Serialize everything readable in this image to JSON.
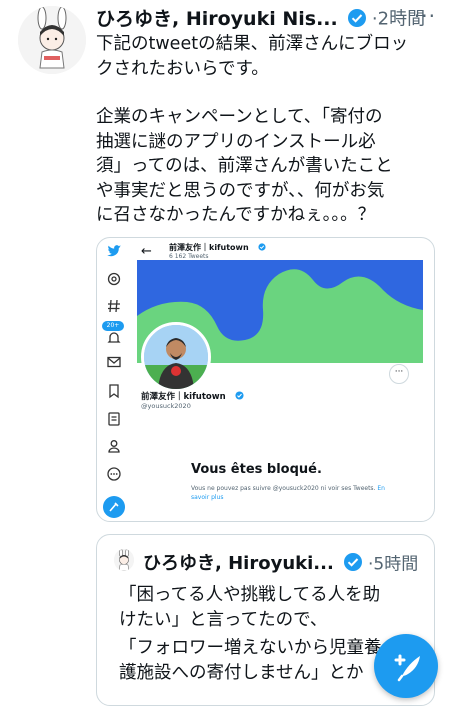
{
  "tweet": {
    "author_name": "ひろゆき, Hiroyuki Nis...",
    "time": "·2時間",
    "more_label": "···",
    "paragraph1": "下記のtweetの結果、前澤さんにブロッ\nクされたおいらです。",
    "paragraph2": "企業のキャンペーンとして、「寄付の\n抽選に謎のアプリのインストール必\n須」ってのは、前澤さんが書いたこと\nや事実だと思うのですが、、何がお気\nに召さなかったんですかねぇ。。。？"
  },
  "embedded_screenshot": {
    "profile_name": "前澤友作｜kifutown",
    "tweet_count": "6 162 Tweets",
    "display_name": "前澤友作｜kifutown",
    "handle": "@yousuck2020",
    "blocked_title": "Vous êtes bloqué.",
    "blocked_message": "Vous ne pouvez pas suivre @yousuck2020 ni voir ses Tweets.",
    "learn_more": "En savoir plus",
    "notification_badge": "20+",
    "accent_color": "#1d9bf0",
    "banner_green": "#6ad47f",
    "banner_blue": "#2f67e0",
    "sidebar_icons": [
      "twitter-bird-icon",
      "explore-icon",
      "hashtag-icon",
      "notifications-icon",
      "messages-icon",
      "bookmark-icon",
      "lists-icon",
      "profile-icon",
      "more-icon",
      "compose-icon"
    ]
  },
  "quoted_tweet": {
    "author_name": "ひろゆき, Hiroyuki...",
    "time": "·5時間",
    "paragraph1": "「困ってる人や挑戦してる人を助\nけたい」と言ってたので、",
    "paragraph2": "「フォロワー増えないから児童養\n護施設への寄付しません」とか"
  },
  "compose_button": {
    "icon": "compose-icon",
    "color": "#1d9bf0"
  }
}
